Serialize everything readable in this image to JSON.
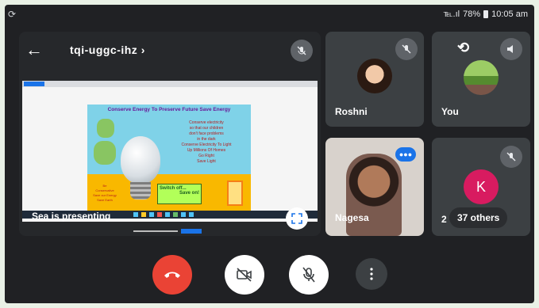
{
  "status_bar": {
    "left_icon": "sync-icon",
    "signal": "℡.ıl",
    "battery": "78%",
    "time": "10:05 am"
  },
  "presentation": {
    "meeting_code": "tqi-uggc-ihz",
    "presenter_label": "Sea is presenting",
    "slide": {
      "title": "Conserve Energy To Preserve Future Save Energy",
      "lines_right": [
        "Conserve electricity",
        "so that our children",
        "don't face problems",
        "in the dark",
        "",
        "Conserve Electricity To Light",
        "Up Millions Of Homes",
        "Go Right",
        "Save Light"
      ],
      "sign_text": [
        "Switch off...",
        "Save on!"
      ],
      "left_note": [
        "Be",
        "Conservative",
        "Save our Energy",
        "Save Earth"
      ]
    }
  },
  "participants": [
    {
      "name": "Roshni"
    },
    {
      "name": "You"
    },
    {
      "name": "Nagesa"
    },
    {
      "name": "2",
      "avatar_letter": "K",
      "avatar_color": "#d81b60",
      "others_label": "37 others"
    }
  ],
  "colors": {
    "background": "#202124",
    "tile": "#3c4043",
    "end_call": "#ea4335",
    "accent_blue": "#1a73e8"
  }
}
